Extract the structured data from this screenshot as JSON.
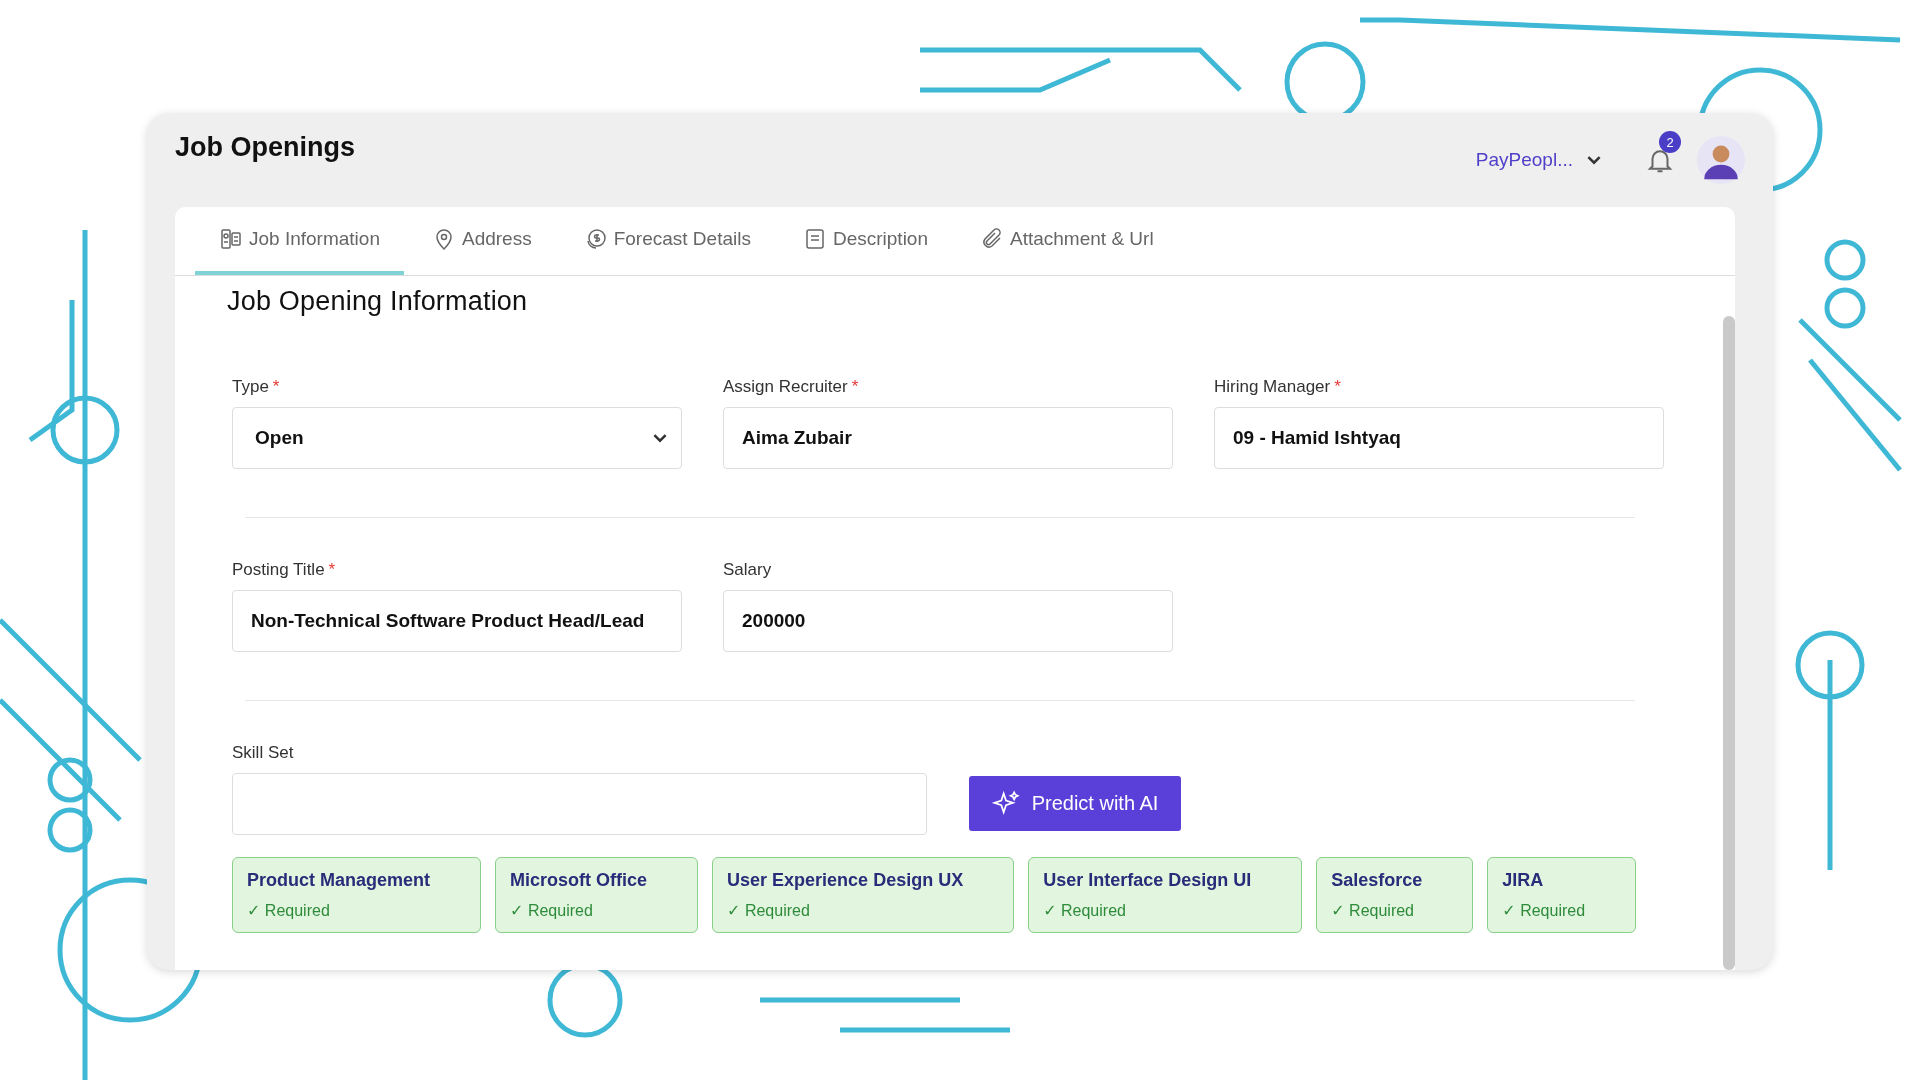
{
  "header": {
    "title": "Job Openings",
    "company": "PayPeopl...",
    "notifications": "2"
  },
  "tabs": [
    {
      "label": "Job Information",
      "selected": true
    },
    {
      "label": "Address",
      "selected": false
    },
    {
      "label": "Forecast Details",
      "selected": false
    },
    {
      "label": "Description",
      "selected": false
    },
    {
      "label": "Attachment & Url",
      "selected": false
    }
  ],
  "section_title": "Job Opening Information",
  "field_rows": [
    [
      {
        "label": "Type",
        "required_mark": "*",
        "value": "Open",
        "kind": "select"
      },
      {
        "label": "Assign Recruiter",
        "required_mark": "*",
        "value": "Aima Zubair",
        "kind": "text"
      },
      {
        "label": "Hiring Manager",
        "required_mark": "*",
        "value": "09 - Hamid Ishtyaq",
        "kind": "text"
      }
    ],
    [
      {
        "label": "Posting Title",
        "required_mark": "*",
        "value": "Non-Technical Software Product Head/Lead",
        "kind": "text"
      },
      {
        "label": "Salary",
        "value": "200000",
        "kind": "text"
      }
    ]
  ],
  "skill_set": {
    "label": "Skill Set",
    "button": "Predict with AI"
  },
  "skills": [
    {
      "name": "Product Management",
      "note": "✓ Required"
    },
    {
      "name": "Microsoft Office",
      "note": "✓ Required"
    },
    {
      "name": "User Experience Design UX",
      "note": "✓ Required"
    },
    {
      "name": "User Interface Design UI",
      "note": "✓ Required"
    },
    {
      "name": "Salesforce",
      "note": "✓ Required"
    },
    {
      "name": "JIRA",
      "note": "✓ Required"
    }
  ]
}
